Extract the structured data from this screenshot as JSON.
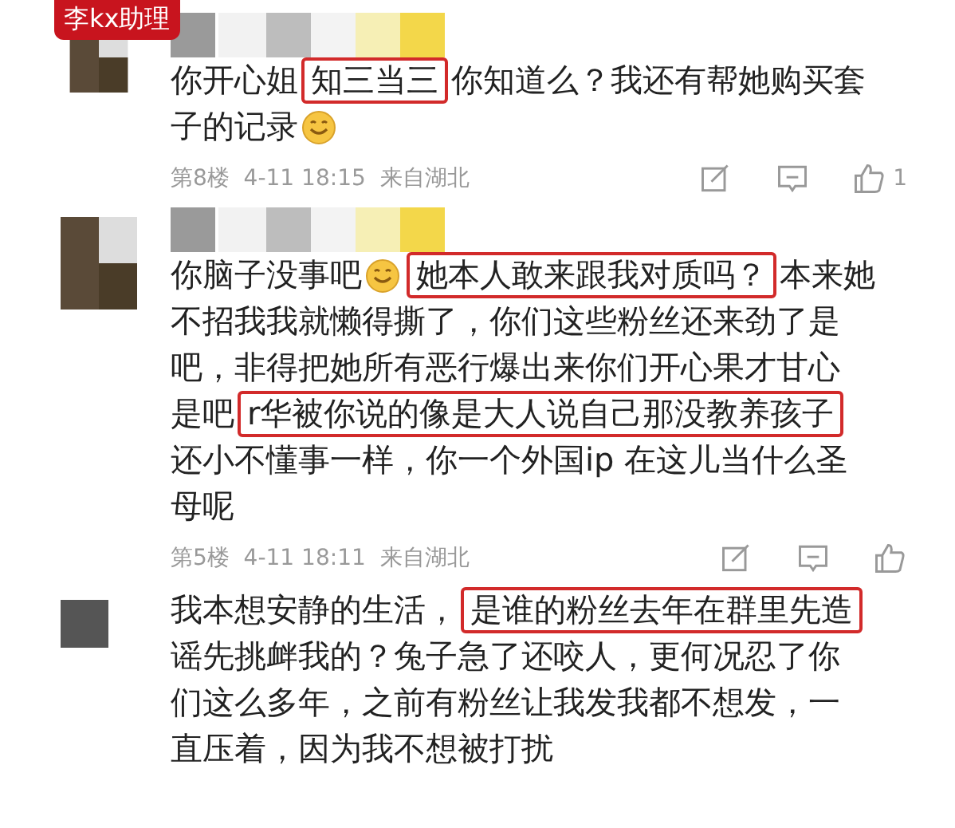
{
  "tag": "李kx助理",
  "comments": [
    {
      "kind": "mosaic",
      "lines": [
        [
          {
            "kind": "text",
            "text": "你开心姐"
          },
          {
            "kind": "highlight",
            "text": "知三当三"
          },
          {
            "kind": "text",
            "text": "你知道么？我还有帮她购买套"
          }
        ],
        [
          {
            "kind": "text",
            "text": "子的记录"
          },
          {
            "kind": "emoji"
          }
        ]
      ],
      "meta": "第8楼  4-11 18:15  来自湖北",
      "likes": "1"
    },
    {
      "kind": "mosaic",
      "lines": [
        [
          {
            "kind": "text",
            "text": "你脑子没事吧"
          },
          {
            "kind": "emoji"
          },
          {
            "kind": "highlight",
            "text": "她本人敢来跟我对质吗？"
          },
          {
            "kind": "text",
            "text": "本来她"
          }
        ],
        [
          {
            "kind": "text",
            "text": "不招我我就懒得撕了，你们这些粉丝还来劲了是"
          }
        ],
        [
          {
            "kind": "text",
            "text": "吧，非得把她所有恶行爆出来你们开心果才甘心"
          }
        ],
        [
          {
            "kind": "text",
            "text": "是吧"
          },
          {
            "kind": "highlight",
            "text": "r华被你说的像是大人说自己那没教养孩子"
          }
        ],
        [
          {
            "kind": "text",
            "text": "还小不懂事一样，你一个外国ip 在这儿当什么圣"
          }
        ],
        [
          {
            "kind": "text",
            "text": "母呢"
          }
        ]
      ],
      "meta": "第5楼  4-11 18:11  来自湖北"
    },
    {
      "kind": "plain",
      "lines": [
        [
          {
            "kind": "text",
            "text": "我本想安静的生活，"
          },
          {
            "kind": "highlight",
            "text": "是谁的粉丝去年在群里先造"
          }
        ],
        [
          {
            "kind": "text",
            "text": "谣先挑衅我的？兔子急了还咬人，更何况忍了你"
          }
        ],
        [
          {
            "kind": "text",
            "text": "们这么多年，之前有粉丝让我发我都不想发，一"
          }
        ],
        [
          {
            "kind": "text",
            "text": "直压着，因为我不想被打扰"
          }
        ]
      ]
    }
  ]
}
